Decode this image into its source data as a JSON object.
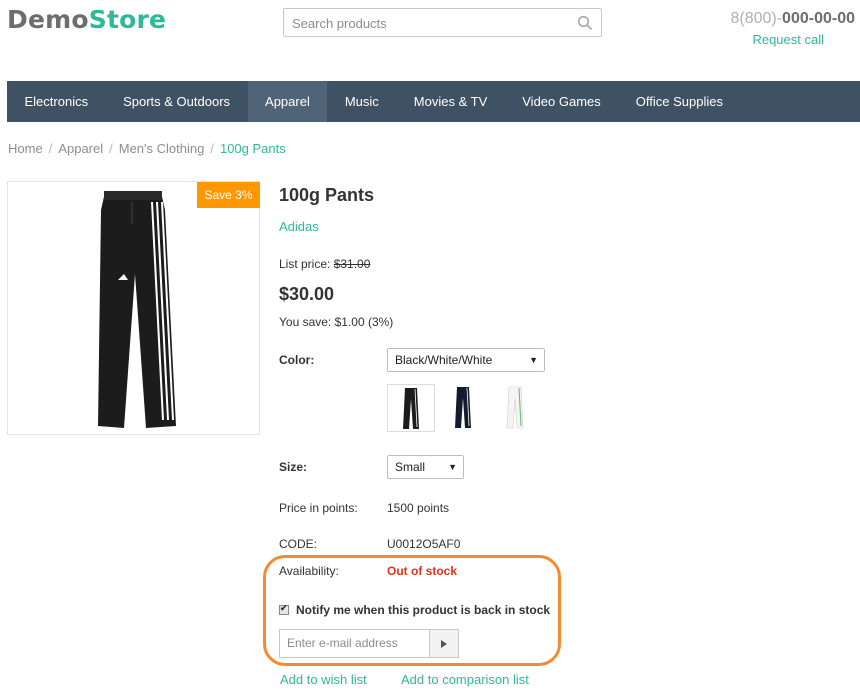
{
  "header": {
    "logo_part1": "Demo",
    "logo_part2": "Store",
    "search_placeholder": "Search products",
    "phone_prefix": "8(800)-",
    "phone_main": "000-00-00",
    "request_call": "Request call",
    "logo_colors": {
      "part1": "#6d6d6d",
      "part2": "#2fb89a"
    }
  },
  "nav": {
    "items": [
      "Electronics",
      "Sports & Outdoors",
      "Apparel",
      "Music",
      "Movies & TV",
      "Video Games",
      "Office Supplies"
    ],
    "active": "Apparel",
    "background": "#3f5264"
  },
  "breadcrumb": {
    "items": [
      "Home",
      "Apparel",
      "Men's Clothing"
    ],
    "separator": "/",
    "current": "100g Pants"
  },
  "product": {
    "badge": "Save 3%",
    "title": "100g Pants",
    "brand": "Adidas",
    "list_price_label": "List price:",
    "list_price": "$31.00",
    "price": "$30.00",
    "you_save": "You save: $1.00 (3%)",
    "color_label": "Color:",
    "color_value": "Black/White/White",
    "color_swatch_icons": [
      "pants-black-white-icon",
      "pants-navy-white-icon",
      "pants-white-green-icon"
    ],
    "size_label": "Size:",
    "size_value": "Small",
    "points_label": "Price in points:",
    "points_value": "1500 points",
    "code_label": "CODE:",
    "code_value": "U0012O5AF0",
    "availability_label": "Availability:",
    "availability_value": "Out of stock",
    "notify_label": "Notify me when this product is back in stock",
    "notify_checked": true,
    "email_placeholder": "Enter e-mail address",
    "wish_list": "Add to wish list",
    "comparison_list": "Add to comparison list"
  },
  "colors": {
    "accent": "#2fb89a",
    "badge": "#ff9800",
    "out_of_stock": "#e0321c",
    "highlight": "#f58a2e"
  }
}
